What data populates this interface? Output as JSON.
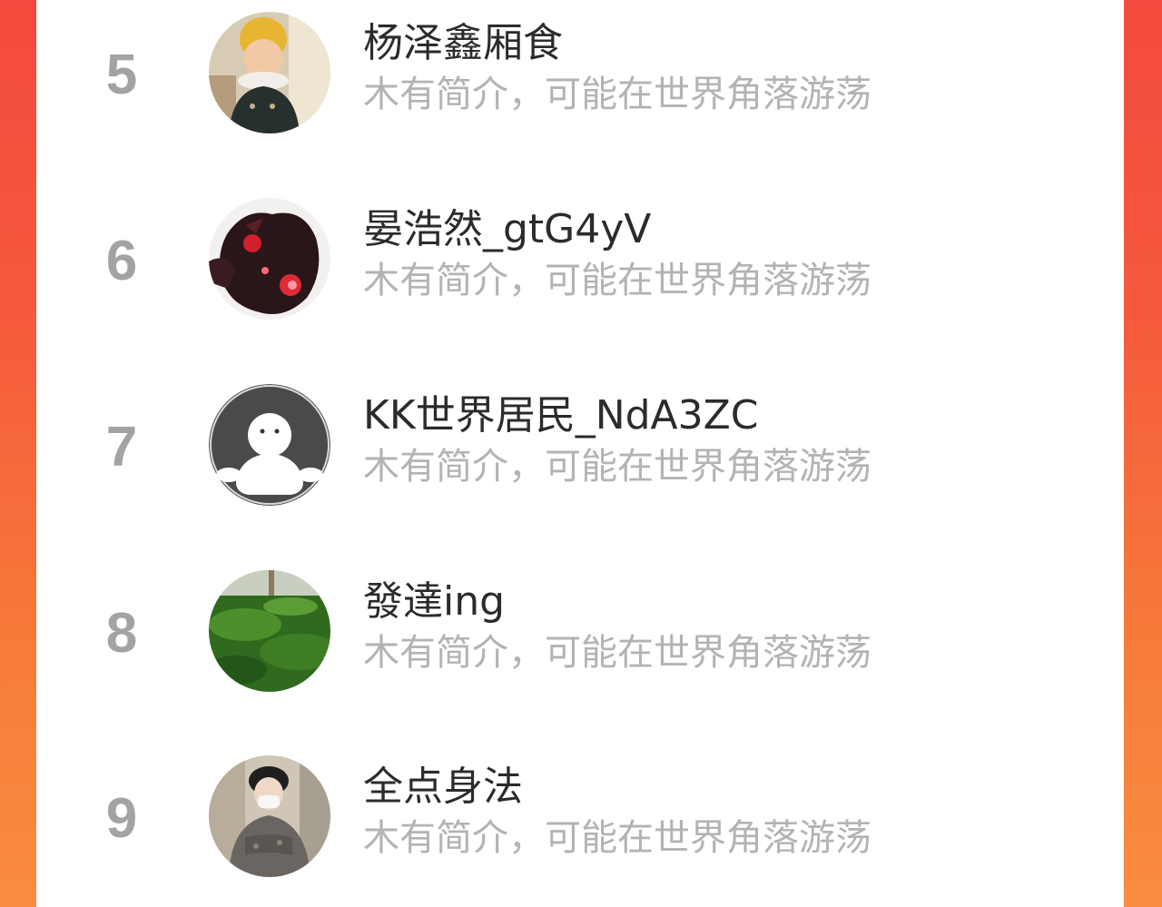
{
  "ranking": {
    "items": [
      {
        "rank": "5",
        "name": "杨泽鑫厢食",
        "bio": "木有简介，可能在世界角落游荡",
        "avatar_icon": "baby-photo-avatar"
      },
      {
        "rank": "6",
        "name": "晏浩然_gtG4yV",
        "bio": "木有简介，可能在世界角落游荡",
        "avatar_icon": "dark-art-avatar"
      },
      {
        "rank": "7",
        "name": "KK世界居民_NdA3ZC",
        "bio": "木有简介，可能在世界角落游荡",
        "avatar_icon": "default-ghost-avatar"
      },
      {
        "rank": "8",
        "name": "發達ing",
        "bio": "木有简介，可能在世界角落游荡",
        "avatar_icon": "grass-lawn-avatar"
      },
      {
        "rank": "9",
        "name": "全点身法",
        "bio": "木有简介，可能在世界角落游荡",
        "avatar_icon": "masked-person-avatar"
      }
    ]
  },
  "colors": {
    "background_gradient_top": "#f4493e",
    "background_gradient_bottom": "#f98d3f",
    "rank_number": "#a3a3a3",
    "name_text": "#2b2b2b",
    "bio_text": "#b3b3b3"
  }
}
